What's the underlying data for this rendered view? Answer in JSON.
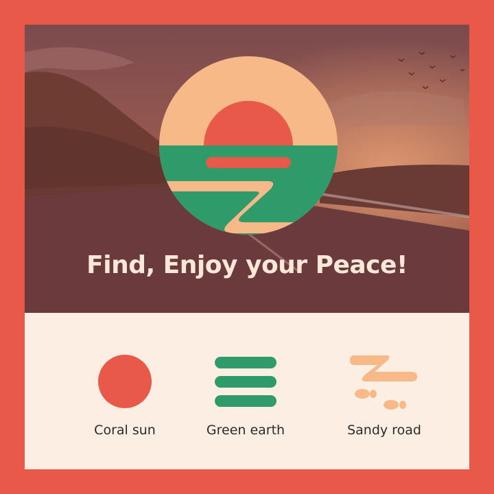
{
  "hero": {
    "title": "Find, Enjoy your Peace!"
  },
  "features": [
    {
      "label": "Coral sun",
      "icon": "sun-circle-icon"
    },
    {
      "label": "Green earth",
      "icon": "three-bars-icon"
    },
    {
      "label": "Sandy road",
      "icon": "road-footprints-icon"
    }
  ],
  "colors": {
    "coral": "#e8594a",
    "green": "#2f9a6a",
    "sand": "#f6b987",
    "cream": "#fdeee3",
    "hero_overlay": "#8a4a43"
  }
}
